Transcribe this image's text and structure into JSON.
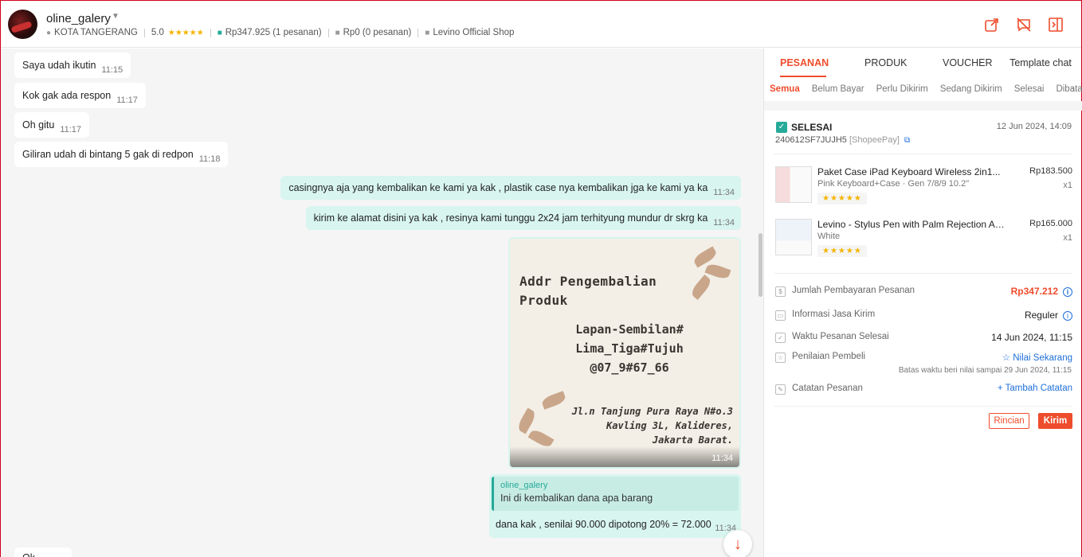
{
  "header": {
    "shop_name": "oline_galery",
    "location": "KOTA TANGERANG",
    "rating": "5.0",
    "paid_total": "Rp347.925 (1 pesanan)",
    "unpaid_total": "Rp0 (0 pesanan)",
    "store_label": "Levino Official Shop"
  },
  "chat": {
    "incoming": [
      {
        "text": "Saya udah ikutin",
        "time": "11:15"
      },
      {
        "text": "Kok gak ada respon",
        "time": "11:17"
      },
      {
        "text": "Oh gitu",
        "time": "11:17"
      },
      {
        "text": "Giliran udah di bintang 5 gak di redpon",
        "time": "11:18"
      }
    ],
    "outgoing": [
      {
        "text": "casingnya aja yang kembalikan ke kami ya kak , plastik case nya kembalikan jga ke kami ya ka",
        "time": "11:34"
      },
      {
        "text": "kirim ke alamat disini ya kak , resinya kami tunggu 2x24 jam terhityung mundur dr skrg ka",
        "time": "11:34"
      }
    ],
    "image": {
      "title_line1": "Addr Pengembalian",
      "title_line2": "Produk",
      "code_line1": "Lapan-Sembilan#",
      "code_line2": "Lima_Tiga#Tujuh",
      "code_line3": "@07_9#67_66",
      "addr_line1": "Jl.n Tanjung Pura Raya N#o.3",
      "addr_line2": "Kavling 3L, Kalideres,",
      "addr_line3": "Jakarta Barat.",
      "time": "11:34"
    },
    "reply": {
      "quoted_name": "oline_galery",
      "quoted_text": "Ini di kembalikan dana apa barang",
      "text": "dana kak , senilai 90.000 dipotong 20% = 72.000",
      "time": "11:34"
    },
    "partial_text": "Ok"
  },
  "panel": {
    "tabs": [
      "PESANAN",
      "PRODUK",
      "VOUCHER",
      "Template chat"
    ],
    "subtabs": [
      "Semua",
      "Belum Bayar",
      "Perlu Dikirim",
      "Sedang Dikirim",
      "Selesai",
      "Dibata"
    ],
    "order": {
      "status": "SELESAI",
      "date": "12 Jun 2024, 14:09",
      "order_id": "240612SF7JUJH5",
      "payment": "[ShopeePay]",
      "products": [
        {
          "name": "Paket Case iPad Keyboard Wireless 2in1...",
          "variant": "Pink Keyboard+Case · Gen 7/8/9 10.2\"",
          "price": "Rp183.500",
          "qty": "x1",
          "stars": "★★★★★"
        },
        {
          "name": "Levino - Stylus Pen with Palm Rejection Apple...",
          "variant": "White",
          "price": "Rp165.000",
          "qty": "x1",
          "stars": "★★★★★"
        }
      ],
      "payment_label": "Jumlah Pembayaran Pesanan",
      "payment_value": "Rp347.212",
      "shipping_label": "Informasi Jasa Kirim",
      "shipping_value": "Reguler",
      "completed_label": "Waktu Pesanan Selesai",
      "completed_value": "14 Jun 2024, 11:15",
      "review_label": "Penilaian Pembeli",
      "review_value": "☆ Nilai Sekarang",
      "review_deadline": "Batas waktu beri nilai sampai 29 Jun 2024, 11:15",
      "note_label": "Catatan Pesanan",
      "note_value": "+ Tambah Catatan",
      "btn_detail": "Rincian",
      "btn_send": "Kirim"
    }
  },
  "colors": {
    "accent": "#ee4d2d",
    "teal": "#26aa99",
    "bubble_out": "#d8f5ef",
    "link": "#1e6fd9"
  }
}
